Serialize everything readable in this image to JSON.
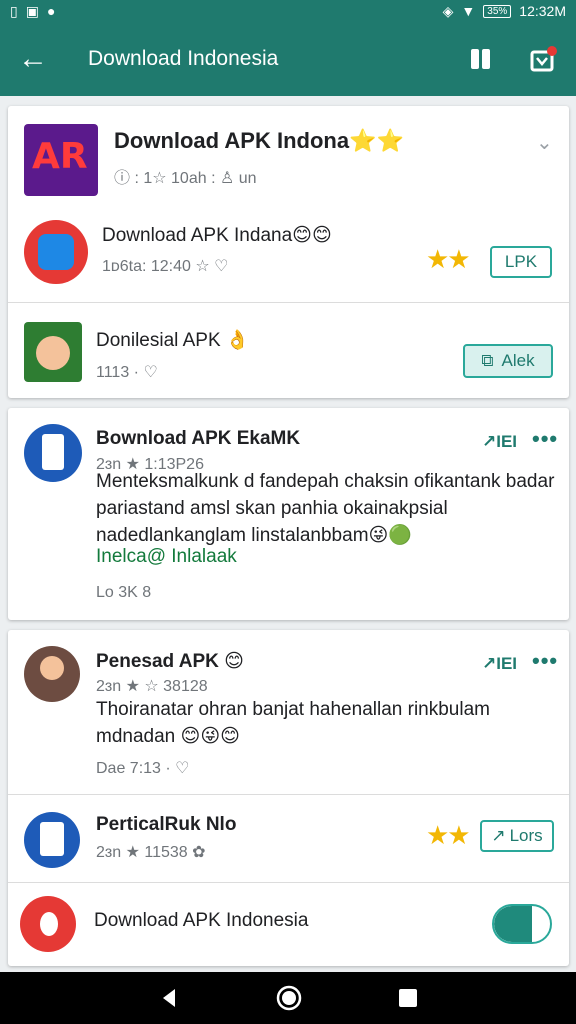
{
  "status": {
    "left_icons": [
      "sim-icon",
      "image-icon",
      "notification-icon"
    ],
    "battery": "35%",
    "time": "12:32M"
  },
  "appbar": {
    "title": "Download Indonesia"
  },
  "card1": {
    "item1": {
      "icon_text": "AR",
      "title": "Download APK Indona⭐⭐",
      "meta": "ⓘ : 1☆ 10ah : ♙ un"
    },
    "item2": {
      "title": "Download APK Indana😊😊",
      "meta": "1ᴅ6ta: 12:40 ☆ ♡",
      "stars": "★★",
      "button": "LPK"
    },
    "item3": {
      "title": "Donilesial APK 👌",
      "meta": "1113 · ♡",
      "button": "Alek"
    }
  },
  "card2": {
    "title": "Bownload APK EkaMK",
    "meta": "2ɜn ★ 1:13P26",
    "trend": "↗IEI",
    "dots": "•••",
    "body": "Menteksmalkunk d fandepah chaksin ofikantank badar pariastand amsl skan panhia okainakpsial nadedlankanglam linstalanbbam😜🟢",
    "link": "Inelca@ Inlalaak",
    "footer": "Lo 3K 8"
  },
  "card3": {
    "post": {
      "title": "Penesad APK 😊",
      "meta": "2ɜn ★ ☆ 38128",
      "trend": "↗IEI",
      "dots": "•••",
      "body": "Thoiranatar ohran banjat hahenallan rinkbulam mdnadan 😊😜😊",
      "footer": "Dae 7:13 · ♡"
    },
    "app": {
      "title": "PerticalRuk Nlo",
      "meta": "2ɜn ★ 11538 ✿",
      "stars": "★★",
      "button": "Lors"
    },
    "banner": {
      "title": "Download APK Indonesia"
    }
  },
  "colors": {
    "primary": "#1f7a6e",
    "accent": "#2aa89a",
    "star": "#f2b705",
    "link": "#137a3c"
  }
}
